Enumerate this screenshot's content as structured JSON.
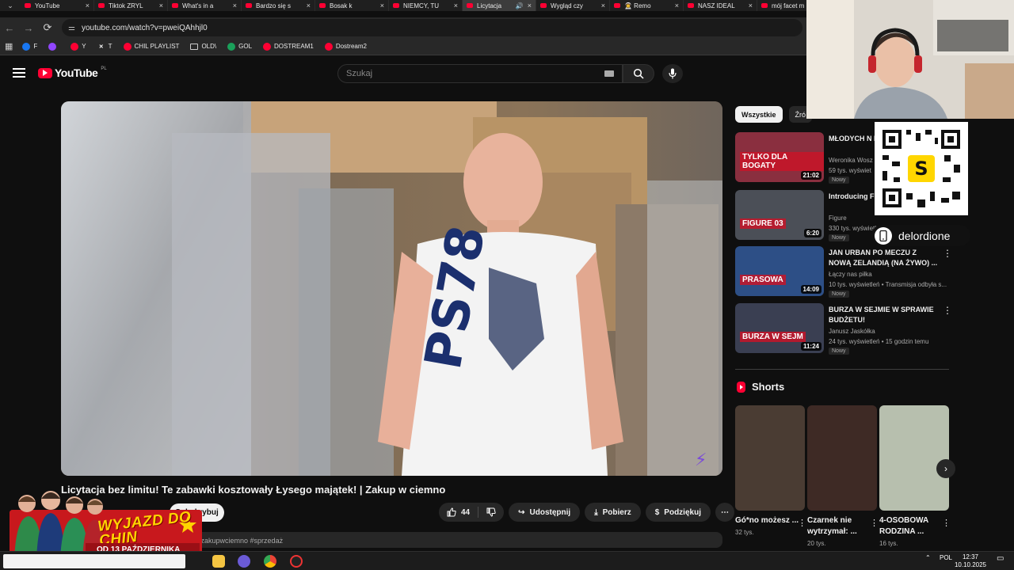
{
  "browser": {
    "tabs": [
      {
        "label": "YouTube",
        "active": false
      },
      {
        "label": "Tiktok ZRYL",
        "active": false
      },
      {
        "label": "What's in a",
        "active": false
      },
      {
        "label": "Bardzo się s",
        "active": false
      },
      {
        "label": "Bosak k",
        "active": false
      },
      {
        "label": "NIEMCY, TU",
        "active": false
      },
      {
        "label": "Licytacja",
        "active": true
      },
      {
        "label": "Wygląd czy",
        "active": false
      },
      {
        "label": "👨‍🚀 Remo",
        "active": false
      },
      {
        "label": "NASZ IDEAL",
        "active": false
      },
      {
        "label": "mój facet m",
        "active": false
      }
    ],
    "url": "youtube.com/watch?v=pweiQAhhjl0",
    "bookmarks": [
      {
        "label": "F",
        "icon": "facebook-icon",
        "color": "#1877f2"
      },
      {
        "label": "",
        "icon": "twitch-icon",
        "color": "#9146ff"
      },
      {
        "label": "Y",
        "icon": "youtube-icon",
        "color": "#ff0033"
      },
      {
        "label": "T",
        "icon": "x-icon",
        "color": "#ffffff"
      },
      {
        "label": "CHIL PLAYLIST",
        "icon": "youtube-icon",
        "color": "#ff0033"
      },
      {
        "label": "OLD\\",
        "icon": "folder-icon",
        "color": "#cccccc"
      },
      {
        "label": "GOL",
        "icon": "gol-icon",
        "color": "#1aa05a"
      },
      {
        "label": "DOSTREAM1",
        "icon": "youtube-icon",
        "color": "#ff0033"
      },
      {
        "label": "Dostream2",
        "icon": "youtube-icon",
        "color": "#ff0033"
      }
    ]
  },
  "youtube": {
    "logo_text": "YouTube",
    "country": "PL",
    "search_placeholder": "Szukaj"
  },
  "video": {
    "title": "Licytacja bez limitu! Te zabawki kosztowały Łysego majątek! | Zakup w ciemno",
    "subscribe_label": "Subskrybuj",
    "likes": "44",
    "share_label": "Udostępnij",
    "download_label": "Pobierz",
    "thanks_label": "Podziękuj",
    "description_snippet": "azyn #zakupwciemno #sprzedaż"
  },
  "sidebar": {
    "chips": [
      {
        "label": "Wszystkie",
        "selected": true
      },
      {
        "label": "Źró",
        "selected": false
      }
    ],
    "recommendations": [
      {
        "title": "MŁODYCH N MIESZKANIA",
        "channel": "Weronika Wosz",
        "meta": "59 tys. wyświet",
        "badge": "Nowy",
        "duration": "21:02",
        "thumb_text": "TYLKO DLA BOGATY"
      },
      {
        "title": "Introducing F",
        "channel": "Figure",
        "meta": "330 tys. wyświetleń • 16 godzin temu",
        "badge": "Nowy",
        "duration": "6:20",
        "thumb_text": "FIGURE 03"
      },
      {
        "title": "JAN URBAN PO MECZU Z NOWĄ ZELANDIĄ (NA ŻYWO) ...",
        "channel": "Łączy nas piłka",
        "meta": "10 tys. wyświetleń • Transmisja odbyła s...",
        "badge": "Nowy",
        "duration": "14:09",
        "thumb_text": "PRASOWA"
      },
      {
        "title": "BURZA W SEJMIE W SPRAWIE BUDŻETU!",
        "channel": "Janusz Jaskółka",
        "meta": "24 tys. wyświetleń • 15 godzin temu",
        "badge": "Nowy",
        "duration": "11:24",
        "thumb_text": "BURZA W SEJM"
      }
    ],
    "shorts_heading": "Shorts",
    "shorts": [
      {
        "title": "Gó*no możesz ...",
        "views": "32 tys."
      },
      {
        "title": "Czarnek nie wytrzymał: ...",
        "views": "20 tys."
      },
      {
        "title": "4-OSOBOWA RODZINA ...",
        "views": "16 tys."
      }
    ]
  },
  "overlay": {
    "handle": "delordione",
    "promo_headline": "WYJAZD DO CHIN",
    "promo_date": "OD 13 PAŹDZIERNIKA"
  },
  "taskbar": {
    "language": "POL",
    "time": "12:37",
    "date": "10.10.2025"
  },
  "colors": {
    "accent": "#ff0033",
    "background": "#0f0f0f",
    "surface": "#272727"
  }
}
